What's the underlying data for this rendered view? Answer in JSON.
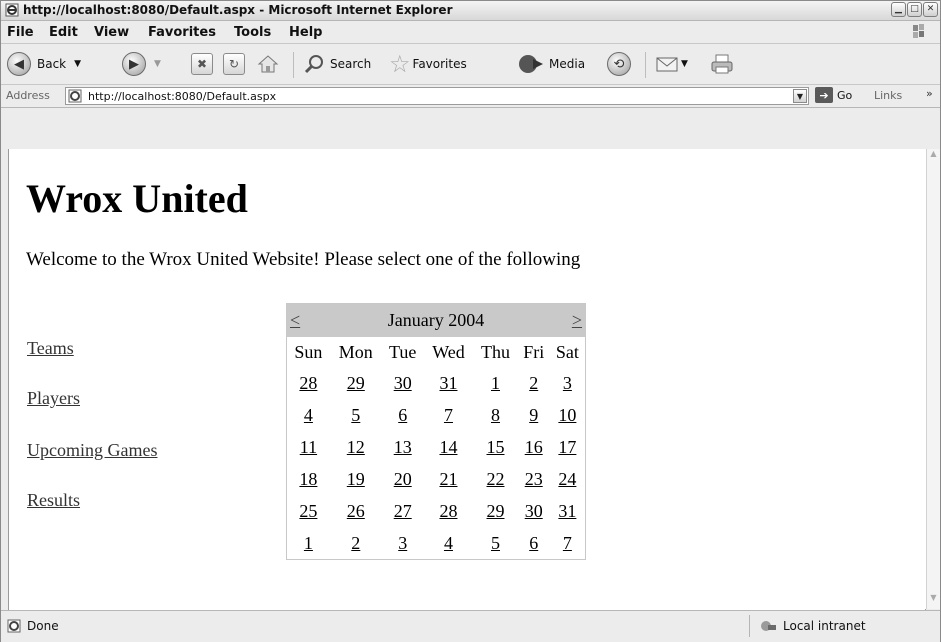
{
  "window": {
    "title": "http://localhost:8080/Default.aspx - Microsoft Internet Explorer"
  },
  "menu": [
    "File",
    "Edit",
    "View",
    "Favorites",
    "Tools",
    "Help"
  ],
  "toolbar": {
    "back": "Back",
    "search": "Search",
    "favorites": "Favorites",
    "media": "Media"
  },
  "address": {
    "label": "Address",
    "url": "http://localhost:8080/Default.aspx",
    "go": "Go",
    "links": "Links"
  },
  "page": {
    "heading": "Wrox United",
    "welcome": "Welcome to the Wrox United Website! Please select one of the following",
    "links": [
      "Teams",
      "Players",
      "Upcoming Games",
      "Results"
    ]
  },
  "calendar": {
    "prev": "<",
    "next": ">",
    "title": "January 2004",
    "days": [
      "Sun",
      "Mon",
      "Tue",
      "Wed",
      "Thu",
      "Fri",
      "Sat"
    ],
    "weeks": [
      [
        "28",
        "29",
        "30",
        "31",
        "1",
        "2",
        "3"
      ],
      [
        "4",
        "5",
        "6",
        "7",
        "8",
        "9",
        "10"
      ],
      [
        "11",
        "12",
        "13",
        "14",
        "15",
        "16",
        "17"
      ],
      [
        "18",
        "19",
        "20",
        "21",
        "22",
        "23",
        "24"
      ],
      [
        "25",
        "26",
        "27",
        "28",
        "29",
        "30",
        "31"
      ],
      [
        "1",
        "2",
        "3",
        "4",
        "5",
        "6",
        "7"
      ]
    ]
  },
  "status": {
    "left": "Done",
    "zone": "Local intranet"
  },
  "colors": {
    "calendar_header": "#c9c9c9",
    "content_bg": "#ffffff",
    "chrome": "#ececec"
  }
}
